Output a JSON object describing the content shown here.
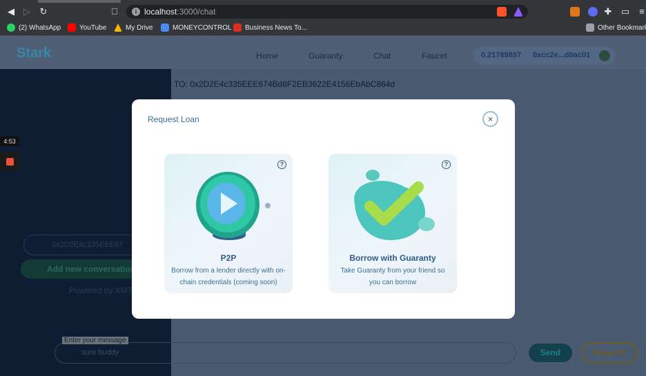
{
  "browser": {
    "url_host": "localhost",
    "url_path": ":3000/chat",
    "bookmarks": [
      {
        "label": "(2) WhatsApp",
        "color": "#25d366"
      },
      {
        "label": "YouTube",
        "color": "#ff0000"
      },
      {
        "label": "My Drive",
        "color": "#f4b400"
      },
      {
        "label": "MONEYCONTROL",
        "color": "#4c8bf5"
      },
      {
        "label": "Business News To...",
        "color": "#d93025"
      }
    ],
    "other_bookmarks": "Other Bookmark"
  },
  "app": {
    "brand": "Stark",
    "nav": [
      "Home",
      "Guaranty",
      "Chat",
      "Faucet"
    ],
    "wallet": {
      "balance": "0.21789897",
      "address": "0xcc2e...d0ac01"
    }
  },
  "sidebar": {
    "address_value": "0x2D2E4c335EEE67",
    "add_conversation": "Add new conversation",
    "powered_by": "Powered by XMT"
  },
  "recorder": {
    "time": "4:53"
  },
  "chat": {
    "to_line": "TO: 0x2D2E4c335EEE674Bd8F2EB3622E4156EbAbC864d",
    "input_label": "Enter your message",
    "input_placeholder": "sure buddy",
    "send_label": "Send",
    "request_label": "Request"
  },
  "modal": {
    "title": "Request Loan",
    "close_glyph": "×",
    "cards": [
      {
        "title": "P2P",
        "desc": "Borrow from a lender directly with on-chain credentials (coming soon)",
        "help": "?"
      },
      {
        "title": "Borrow with Guaranty",
        "desc": "Take Guaranty from your friend so you can borrow",
        "help": "?"
      }
    ]
  },
  "colors": {
    "brand": "#3a86a8",
    "accent_teal": "#2fb39b",
    "check_green": "#9bd94a"
  }
}
